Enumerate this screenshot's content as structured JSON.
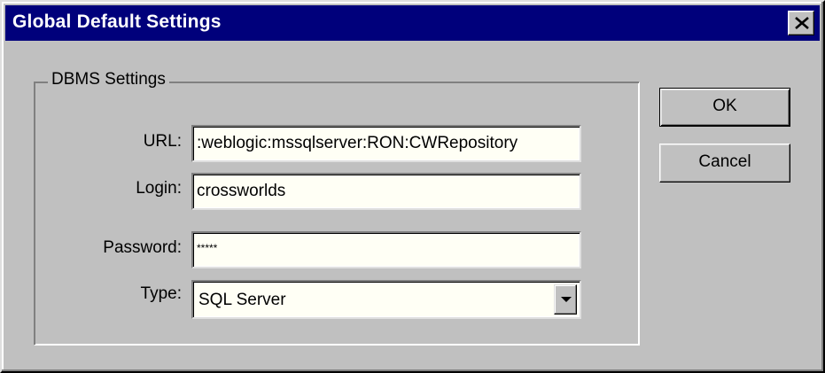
{
  "window": {
    "title": "Global Default Settings",
    "close_icon": "close-icon"
  },
  "dbms": {
    "group_label": "DBMS Settings",
    "url": {
      "label": "URL:",
      "value": ":weblogic:mssqlserver:RON:CWRepository"
    },
    "login": {
      "label": "Login:",
      "value": "crossworlds"
    },
    "password": {
      "label": "Password:",
      "value": "*****"
    },
    "type": {
      "label": "Type:",
      "value": "SQL Server",
      "dropdown_icon": "chevron-down-icon"
    }
  },
  "buttons": {
    "ok": "OK",
    "cancel": "Cancel"
  },
  "colors": {
    "titlebar": "#00007b",
    "face": "#c0c0c0",
    "field_bg": "#fffff5"
  }
}
